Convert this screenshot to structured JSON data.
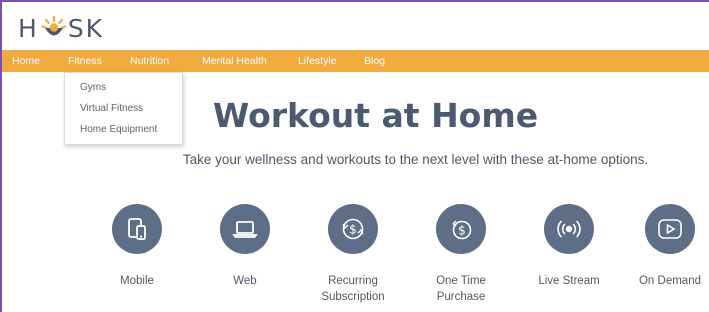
{
  "brand": {
    "letters_left": "H",
    "letters_right": "SK",
    "accent": "#f0aa3f",
    "primary": "#5e6e87"
  },
  "nav": {
    "items": [
      {
        "label": "Home"
      },
      {
        "label": "Fitness"
      },
      {
        "label": "Nutrition"
      },
      {
        "label": "Mental Health"
      },
      {
        "label": "Lifestyle"
      },
      {
        "label": "Blog"
      }
    ]
  },
  "dropdown": {
    "items": [
      {
        "label": "Gyms"
      },
      {
        "label": "Virtual Fitness"
      },
      {
        "label": "Home Equipment"
      }
    ]
  },
  "hero": {
    "title": "Workout at Home",
    "subtitle": "Take your wellness and workouts to the next level with these at-home options."
  },
  "options": [
    {
      "label_line1": "Mobile",
      "label_line2": "",
      "icon": "mobile-tablet-icon"
    },
    {
      "label_line1": "Web",
      "label_line2": "",
      "icon": "laptop-icon"
    },
    {
      "label_line1": "Recurring",
      "label_line2": "Subscription",
      "icon": "recurring-dollar-icon"
    },
    {
      "label_line1": "One Time",
      "label_line2": "Purchase",
      "icon": "one-time-dollar-icon"
    },
    {
      "label_line1": "Live Stream",
      "label_line2": "",
      "icon": "broadcast-icon"
    },
    {
      "label_line1": "On Demand",
      "label_line2": "",
      "icon": "play-button-icon"
    }
  ]
}
